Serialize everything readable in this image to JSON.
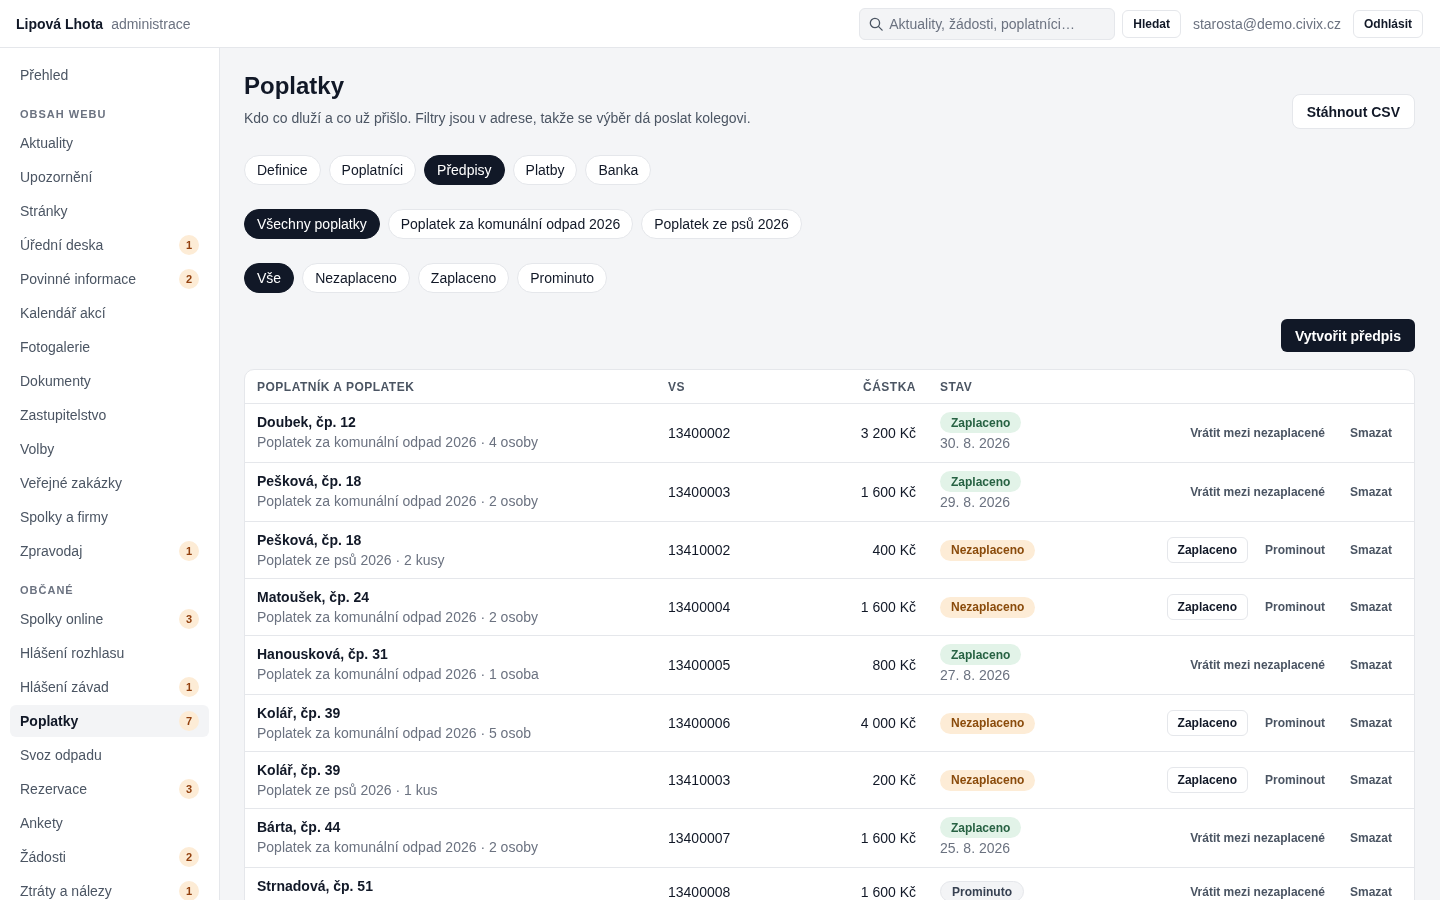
{
  "header": {
    "brand": "Lipová Lhota",
    "subtitle": "administrace",
    "search": {
      "placeholder": "Aktuality, žádosti, poplatníci…"
    },
    "search_button": "Hledat",
    "user_email": "starosta@demo.civix.cz",
    "logout_button": "Odhlásit"
  },
  "sidebar": {
    "items": [
      {
        "kind": "link",
        "label": "Přehled",
        "selected": false
      },
      {
        "kind": "section",
        "label": "OBSAH WEBU"
      },
      {
        "kind": "link",
        "label": "Aktuality",
        "selected": false
      },
      {
        "kind": "link",
        "label": "Upozornění",
        "selected": false
      },
      {
        "kind": "link",
        "label": "Stránky",
        "selected": false
      },
      {
        "kind": "link",
        "label": "Úřední deska",
        "badge": "1",
        "selected": false
      },
      {
        "kind": "link",
        "label": "Povinné informace",
        "badge": "2",
        "selected": false
      },
      {
        "kind": "link",
        "label": "Kalendář akcí",
        "selected": false
      },
      {
        "kind": "link",
        "label": "Fotogalerie",
        "selected": false
      },
      {
        "kind": "link",
        "label": "Dokumenty",
        "selected": false
      },
      {
        "kind": "link",
        "label": "Zastupitelstvo",
        "selected": false
      },
      {
        "kind": "link",
        "label": "Volby",
        "selected": false
      },
      {
        "kind": "link",
        "label": "Veřejné zakázky",
        "selected": false
      },
      {
        "kind": "link",
        "label": "Spolky a firmy",
        "selected": false
      },
      {
        "kind": "link",
        "label": "Zpravodaj",
        "badge": "1",
        "selected": false
      },
      {
        "kind": "section",
        "label": "OBČANÉ"
      },
      {
        "kind": "link",
        "label": "Spolky online",
        "badge": "3",
        "selected": false
      },
      {
        "kind": "link",
        "label": "Hlášení rozhlasu",
        "selected": false
      },
      {
        "kind": "link",
        "label": "Hlášení závad",
        "badge": "1",
        "selected": false
      },
      {
        "kind": "link",
        "label": "Poplatky",
        "badge": "7",
        "selected": true
      },
      {
        "kind": "link",
        "label": "Svoz odpadu",
        "selected": false
      },
      {
        "kind": "link",
        "label": "Rezervace",
        "badge": "3",
        "selected": false
      },
      {
        "kind": "link",
        "label": "Ankety",
        "selected": false
      },
      {
        "kind": "link",
        "label": "Žádosti",
        "badge": "2",
        "selected": false
      },
      {
        "kind": "link",
        "label": "Ztráty a nálezy",
        "badge": "1",
        "selected": false
      }
    ]
  },
  "page": {
    "title": "Poplatky",
    "description": "Kdo co dluží a co už přišlo. Filtry jsou v adrese, takže se výběr dá poslat kolegovi.",
    "export_button": "Stáhnout CSV"
  },
  "tabs": [
    {
      "label": "Definice",
      "selected": false
    },
    {
      "label": "Poplatníci",
      "selected": false
    },
    {
      "label": "Předpisy",
      "selected": true
    },
    {
      "label": "Platby",
      "selected": false
    },
    {
      "label": "Banka",
      "selected": false
    }
  ],
  "fee_filters": [
    {
      "label": "Všechny poplatky",
      "selected": true
    },
    {
      "label": "Poplatek za komunální odpad 2026",
      "selected": false
    },
    {
      "label": "Poplatek ze psů 2026",
      "selected": false
    }
  ],
  "status_filters": [
    {
      "label": "Vše",
      "selected": true
    },
    {
      "label": "Nezaplaceno",
      "selected": false
    },
    {
      "label": "Zaplaceno",
      "selected": false
    },
    {
      "label": "Prominuto",
      "selected": false
    }
  ],
  "create_button": "Vytvořit předpis",
  "table": {
    "columns": [
      "POPLATNÍK A POPLATEK",
      "VS",
      "ČÁSTKA",
      "STAV"
    ],
    "rows": [
      {
        "name": "Doubek, čp. 12",
        "fee": "Poplatek za komunální odpad 2026 · 4 osoby",
        "vs": "13400002",
        "amount": "3 200 Kč",
        "status": {
          "kind": "paid",
          "label": "Zaplaceno"
        },
        "paid_date": "30. 8. 2026",
        "actions": [
          {
            "kind": "text",
            "label": "Vrátit mezi nezaplacené"
          },
          {
            "kind": "text",
            "label": "Smazat"
          }
        ]
      },
      {
        "name": "Pešková, čp. 18",
        "fee": "Poplatek za komunální odpad 2026 · 2 osoby",
        "vs": "13400003",
        "amount": "1 600 Kč",
        "status": {
          "kind": "paid",
          "label": "Zaplaceno"
        },
        "paid_date": "29. 8. 2026",
        "actions": [
          {
            "kind": "text",
            "label": "Vrátit mezi nezaplacené"
          },
          {
            "kind": "text",
            "label": "Smazat"
          }
        ]
      },
      {
        "name": "Pešková, čp. 18",
        "fee": "Poplatek ze psů 2026 · 2 kusy",
        "vs": "13410002",
        "amount": "400 Kč",
        "status": {
          "kind": "unpaid",
          "label": "Nezaplaceno"
        },
        "actions": [
          {
            "kind": "outline",
            "label": "Zaplaceno"
          },
          {
            "kind": "text",
            "label": "Prominout"
          },
          {
            "kind": "text",
            "label": "Smazat"
          }
        ]
      },
      {
        "name": "Matoušek, čp. 24",
        "fee": "Poplatek za komunální odpad 2026 · 2 osoby",
        "vs": "13400004",
        "amount": "1 600 Kč",
        "status": {
          "kind": "unpaid",
          "label": "Nezaplaceno"
        },
        "actions": [
          {
            "kind": "outline",
            "label": "Zaplaceno"
          },
          {
            "kind": "text",
            "label": "Prominout"
          },
          {
            "kind": "text",
            "label": "Smazat"
          }
        ]
      },
      {
        "name": "Hanousková, čp. 31",
        "fee": "Poplatek za komunální odpad 2026 · 1 osoba",
        "vs": "13400005",
        "amount": "800 Kč",
        "status": {
          "kind": "paid",
          "label": "Zaplaceno"
        },
        "paid_date": "27. 8. 2026",
        "actions": [
          {
            "kind": "text",
            "label": "Vrátit mezi nezaplacené"
          },
          {
            "kind": "text",
            "label": "Smazat"
          }
        ]
      },
      {
        "name": "Kolář, čp. 39",
        "fee": "Poplatek za komunální odpad 2026 · 5 osob",
        "vs": "13400006",
        "amount": "4 000 Kč",
        "status": {
          "kind": "unpaid",
          "label": "Nezaplaceno"
        },
        "actions": [
          {
            "kind": "outline",
            "label": "Zaplaceno"
          },
          {
            "kind": "text",
            "label": "Prominout"
          },
          {
            "kind": "text",
            "label": "Smazat"
          }
        ]
      },
      {
        "name": "Kolář, čp. 39",
        "fee": "Poplatek ze psů 2026 · 1 kus",
        "vs": "13410003",
        "amount": "200 Kč",
        "status": {
          "kind": "unpaid",
          "label": "Nezaplaceno"
        },
        "actions": [
          {
            "kind": "outline",
            "label": "Zaplaceno"
          },
          {
            "kind": "text",
            "label": "Prominout"
          },
          {
            "kind": "text",
            "label": "Smazat"
          }
        ]
      },
      {
        "name": "Bárta, čp. 44",
        "fee": "Poplatek za komunální odpad 2026 · 2 osoby",
        "vs": "13400007",
        "amount": "1 600 Kč",
        "status": {
          "kind": "paid",
          "label": "Zaplaceno"
        },
        "paid_date": "25. 8. 2026",
        "actions": [
          {
            "kind": "text",
            "label": "Vrátit mezi nezaplacené"
          },
          {
            "kind": "text",
            "label": "Smazat"
          }
        ]
      },
      {
        "name": "Strnadová, čp. 51",
        "vs": "13400008",
        "amount": "1 600 Kč",
        "status": {
          "kind": "waived",
          "label": "Prominuto"
        },
        "actions": [
          {
            "kind": "text",
            "label": "Vrátit mezi nezaplacené"
          },
          {
            "kind": "text",
            "label": "Smazat"
          }
        ]
      }
    ]
  }
}
